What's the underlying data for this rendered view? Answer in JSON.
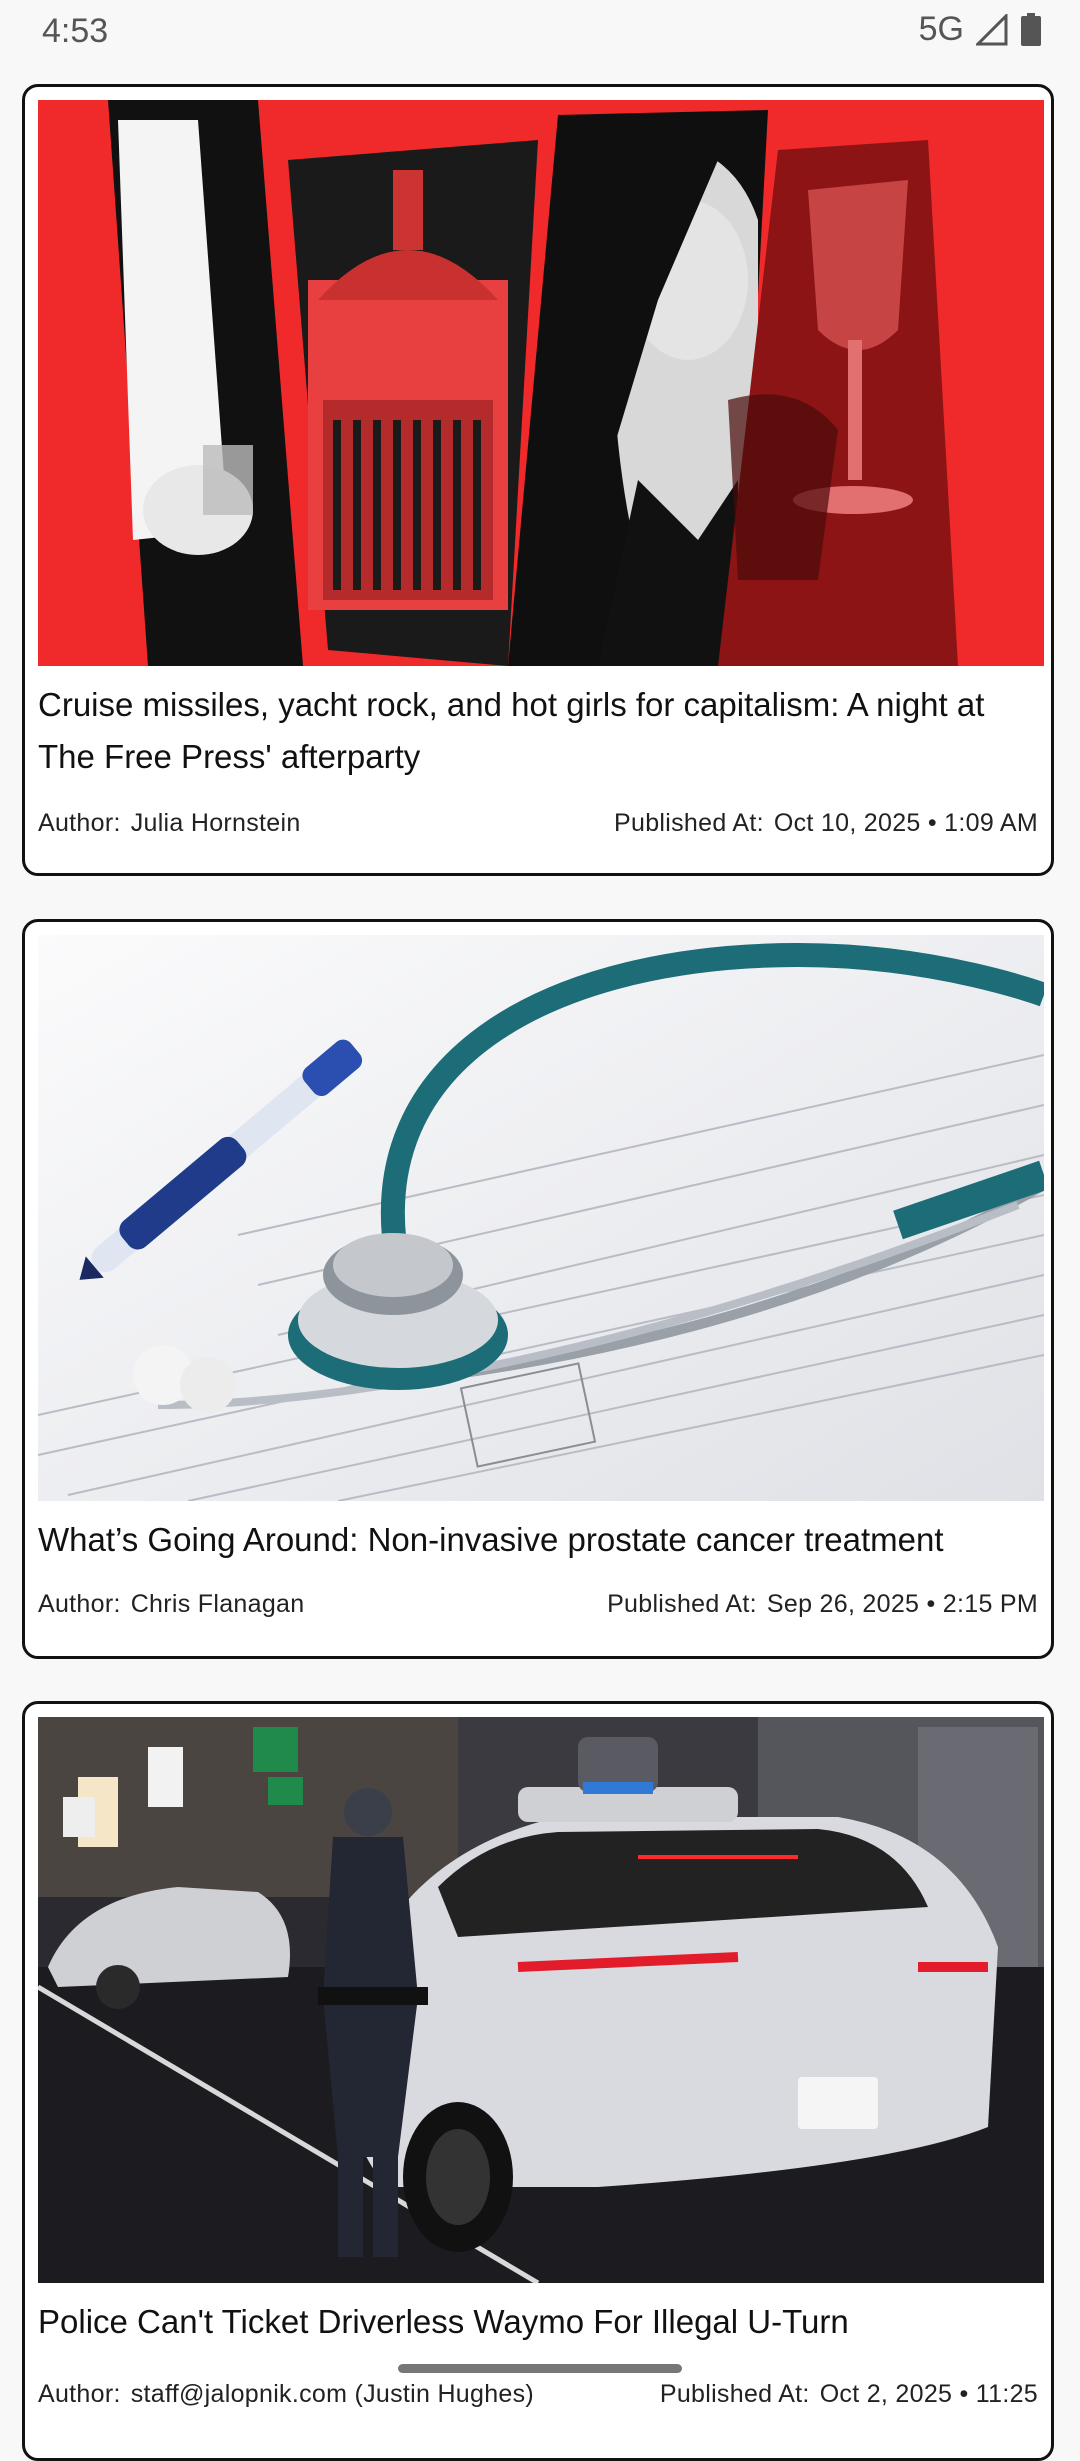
{
  "status_bar": {
    "time": "4:53",
    "network": "5G"
  },
  "articles": [
    {
      "title": "Cruise missiles, yacht rock, and hot girls for capitalism: A night at The Free Press' afterparty",
      "author_label": "Author:",
      "author": "Julia Hornstein",
      "published_label": "Published At:",
      "published": "Oct 10, 2025 • 1:09 AM",
      "image_subject": "collage-red-capitol"
    },
    {
      "title": "What’s Going Around: Non-invasive prostate cancer treatment",
      "author_label": "Author:",
      "author": "Chris Flanagan",
      "published_label": "Published At:",
      "published": "Sep 26, 2025 • 2:15 PM",
      "image_subject": "stethoscope-on-forms"
    },
    {
      "title": "Police Can't Ticket Driverless Waymo For Illegal U-Turn",
      "author_label": "Author:",
      "author": "staff@jalopnik.com (Justin Hughes)",
      "published_label": "Published At:",
      "published": "Oct 2, 2025 • 11:25",
      "image_subject": "police-officer-and-waymo-car"
    }
  ],
  "colors": {
    "background": "#f8f8f8",
    "card_border": "#111111",
    "collage_red": "#f02a2a"
  }
}
